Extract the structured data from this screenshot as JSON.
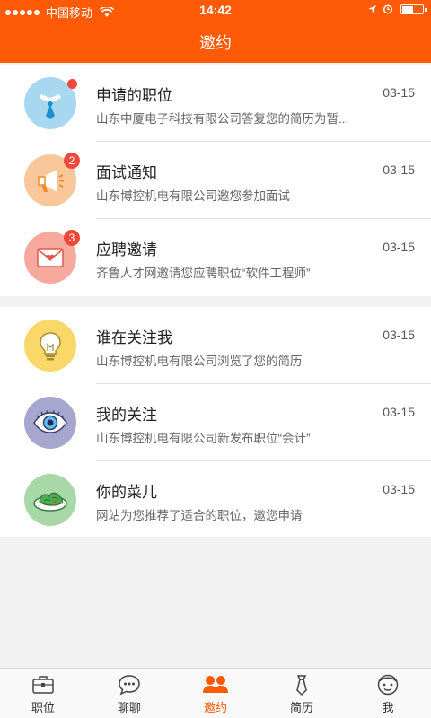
{
  "status_bar": {
    "carrier": "中国移动",
    "time": "14:42"
  },
  "header": {
    "title": "邀约"
  },
  "colors": {
    "accent": "#ff5a06",
    "badge": "#f0493a"
  },
  "group1": [
    {
      "icon": "tie-icon",
      "title": "申请的职位",
      "subtitle": "山东中厦电子科技有限公司答复您的简历为暂...",
      "date": "03-15",
      "badge": ""
    },
    {
      "icon": "megaphone-icon",
      "title": "面试通知",
      "subtitle": "山东博控机电有限公司邀您参加面试",
      "date": "03-15",
      "badge": "2"
    },
    {
      "icon": "envelope-icon",
      "title": "应聘邀请",
      "subtitle": "齐鲁人才网邀请您应聘职位“软件工程师”",
      "date": "03-15",
      "badge": "3"
    }
  ],
  "group2": [
    {
      "icon": "lightbulb-icon",
      "title": "谁在关注我",
      "subtitle": "山东博控机电有限公司浏览了您的简历",
      "date": "03-15"
    },
    {
      "icon": "eye-icon",
      "title": "我的关注",
      "subtitle": "山东博控机电有限公司新发布职位“会计”",
      "date": "03-15"
    },
    {
      "icon": "dish-icon",
      "title": "你的菜儿",
      "subtitle": "网站为您推荐了适合的职位，邀您申请",
      "date": "03-15"
    }
  ],
  "tabs": [
    {
      "icon": "briefcase-icon",
      "label": "职位"
    },
    {
      "icon": "chat-icon",
      "label": "聊聊"
    },
    {
      "icon": "people-icon",
      "label": "邀约",
      "active": true
    },
    {
      "icon": "tie-outline-icon",
      "label": "简历"
    },
    {
      "icon": "face-icon",
      "label": "我"
    }
  ]
}
